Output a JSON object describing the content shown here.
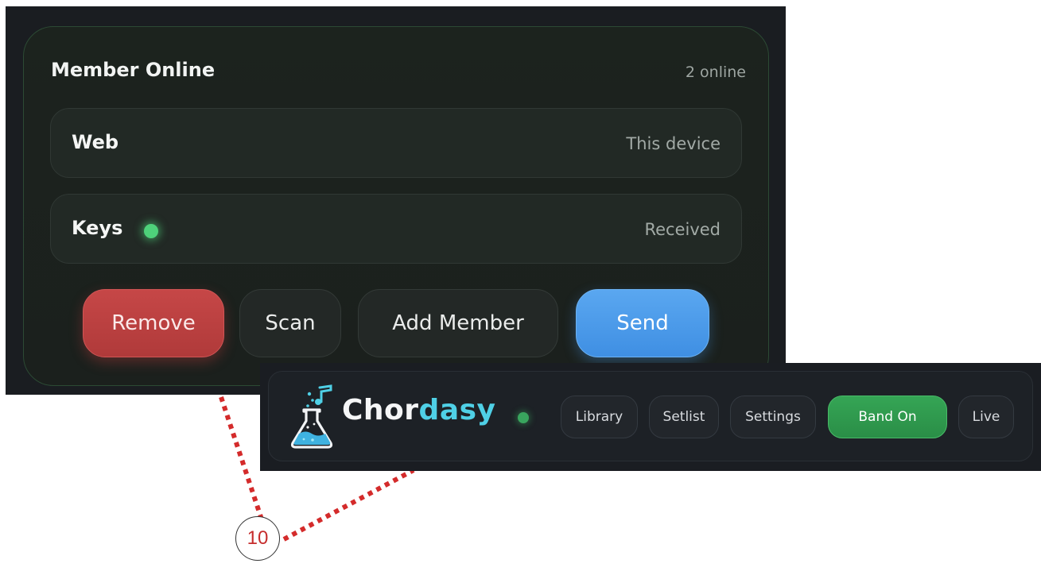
{
  "member_panel": {
    "title": "Member Online",
    "online_count": "2 online",
    "members": [
      {
        "name": "Web",
        "status": "This device",
        "online": false
      },
      {
        "name": "Keys",
        "status": "Received",
        "online": true
      }
    ],
    "buttons": {
      "remove": "Remove",
      "scan": "Scan",
      "add_member": "Add Member",
      "send": "Send"
    }
  },
  "navbar": {
    "brand_part1": "Chor",
    "brand_part2": "dasy",
    "items": {
      "library": "Library",
      "setlist": "Setlist",
      "settings": "Settings",
      "band_on": "Band On",
      "live": "Live"
    }
  },
  "callout": {
    "number": "10"
  },
  "colors": {
    "accent_green": "#35a555",
    "accent_blue": "#4b9be8",
    "danger_red": "#c64747",
    "brand_cyan": "#4fd0e6",
    "callout_red": "#c62d2d"
  }
}
